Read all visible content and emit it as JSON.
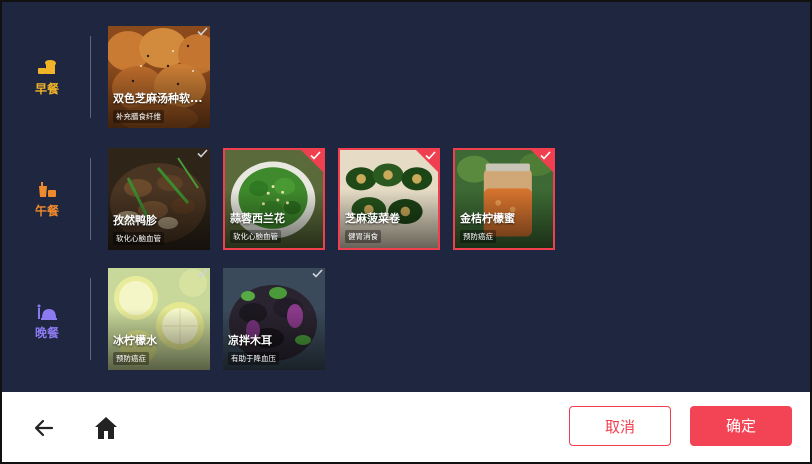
{
  "theme": {
    "background": "#1e2640",
    "accent": "#f34456",
    "breakfast_color": "#f0b429",
    "lunch_color": "#ef8a2c",
    "dinner_color": "#8c7af0"
  },
  "sections": [
    {
      "category": "早餐",
      "icon": "bread-icon",
      "items": [
        {
          "name": "双色芝麻汤种软...",
          "tag": "补充膳食纤维",
          "selected": false,
          "image": "sesame-bread"
        }
      ]
    },
    {
      "category": "午餐",
      "icon": "lunch-icon",
      "items": [
        {
          "name": "孜然鸭胗",
          "tag": "软化心脑血管",
          "selected": false,
          "image": "cumin-duck-gizzard"
        },
        {
          "name": "蒜蓉西兰花",
          "tag": "软化心脑血管",
          "selected": true,
          "image": "garlic-broccoli"
        },
        {
          "name": "芝麻菠菜卷",
          "tag": "健胃消食",
          "selected": true,
          "image": "sesame-spinach-rolls"
        },
        {
          "name": "金桔柠檬蜜",
          "tag": "预防癌症",
          "selected": true,
          "image": "kumquat-lemon-honey"
        }
      ]
    },
    {
      "category": "晚餐",
      "icon": "dinner-icon",
      "items": [
        {
          "name": "冰柠檬水",
          "tag": "预防癌症",
          "selected": false,
          "image": "iced-lemon-water"
        },
        {
          "name": "凉拌木耳",
          "tag": "有助于降血压",
          "selected": false,
          "image": "cold-wood-ear"
        }
      ]
    }
  ],
  "footer": {
    "back_icon": "back-arrow-icon",
    "home_icon": "home-icon",
    "cancel_label": "取消",
    "confirm_label": "确定"
  }
}
